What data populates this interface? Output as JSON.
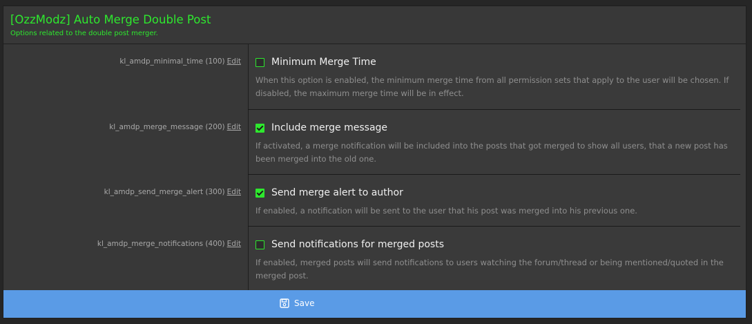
{
  "header": {
    "title": "[OzzModz] Auto Merge Double Post",
    "description": "Options related to the double post merger."
  },
  "options": [
    {
      "key_label": "kl_amdp_minimal_time (100)",
      "edit_label": "Edit",
      "title": "Minimum Merge Time",
      "checked": false,
      "description": "When this option is enabled, the minimum merge time from all permission sets that apply to the user will be chosen. If disabled, the maximum merge time will be in effect."
    },
    {
      "key_label": "kl_amdp_merge_message (200)",
      "edit_label": "Edit",
      "title": "Include merge message",
      "checked": true,
      "description": "If activated, a merge notification will be included into the posts that got merged to show all users, that a new post has been merged into the old one."
    },
    {
      "key_label": "kl_amdp_send_merge_alert (300)",
      "edit_label": "Edit",
      "title": "Send merge alert to author",
      "checked": true,
      "description": "If enabled, a notification will be sent to the user that his post was merged into his previous one."
    },
    {
      "key_label": "kl_amdp_merge_notifications (400)",
      "edit_label": "Edit",
      "title": "Send notifications for merged posts",
      "checked": false,
      "description": "If enabled, merged posts will send notifications to users watching the forum/thread or being mentioned/quoted in the merged post."
    }
  ],
  "footer": {
    "save_label": "Save",
    "save_icon": "save-icon"
  },
  "colors": {
    "accent": "#2ee82e",
    "footer": "#5a9be6",
    "panel": "#3a3a3a"
  }
}
